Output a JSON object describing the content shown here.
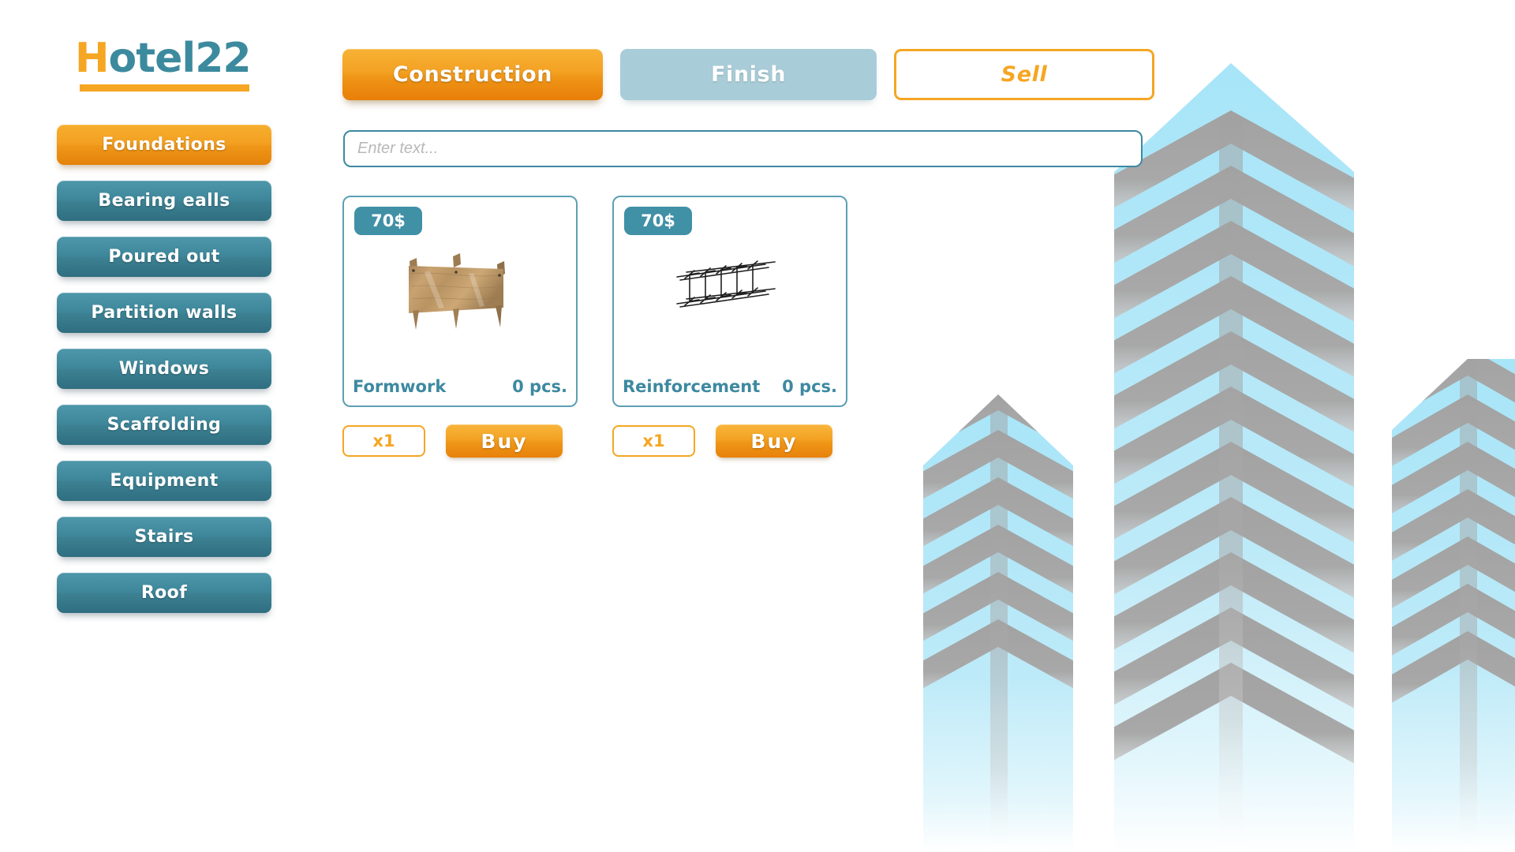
{
  "logo": {
    "prefix": "H",
    "rest": "otel22"
  },
  "sidebar": {
    "items": [
      {
        "label": "Foundations",
        "active": true
      },
      {
        "label": "Bearing ealls",
        "active": false
      },
      {
        "label": "Poured out",
        "active": false
      },
      {
        "label": "Partition walls",
        "active": false
      },
      {
        "label": "Windows",
        "active": false
      },
      {
        "label": "Scaffolding",
        "active": false
      },
      {
        "label": "Equipment",
        "active": false
      },
      {
        "label": "Stairs",
        "active": false
      },
      {
        "label": "Roof",
        "active": false
      }
    ]
  },
  "tabs": [
    {
      "label": "Construction",
      "state": "active"
    },
    {
      "label": "Finish",
      "state": "inactive"
    },
    {
      "label": "Sell",
      "state": "outline"
    }
  ],
  "search": {
    "value": "",
    "placeholder": "Enter text..."
  },
  "products": [
    {
      "price": "70$",
      "name": "Formwork",
      "count": "0 pcs.",
      "quantity": "x1",
      "buy_label": "Buy",
      "icon": "formwork-panel-icon"
    },
    {
      "price": "70$",
      "name": "Reinforcement",
      "count": "0 pcs.",
      "quantity": "x1",
      "buy_label": "Buy",
      "icon": "rebar-cage-icon"
    }
  ],
  "colors": {
    "accent_orange": "#f5a623",
    "teal": "#3d89a0",
    "teal_button": "#3e879b",
    "tab_inactive": "#a9cdd8",
    "skyline_blue": "#b5e8f7",
    "skyline_gray": "#a5a5a5"
  },
  "background": {
    "illustration": "skyscraper-silhouette"
  }
}
